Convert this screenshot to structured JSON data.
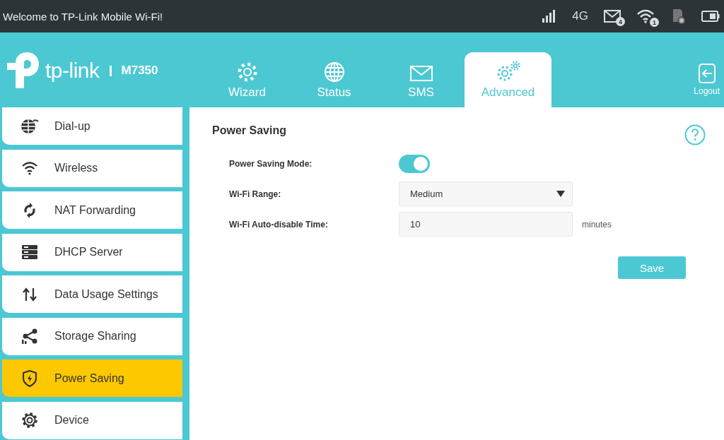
{
  "status_bar": {
    "title": "Welcome to TP-Link Mobile Wi-Fi!",
    "network": "4G",
    "sms_count": "4",
    "wifi_clients": "1"
  },
  "header": {
    "brand": "tp-link",
    "model": "M7350",
    "tabs": [
      {
        "label": "Wizard",
        "selected": false
      },
      {
        "label": "Status",
        "selected": false
      },
      {
        "label": "SMS",
        "selected": false
      },
      {
        "label": "Advanced",
        "selected": true
      }
    ],
    "logout": "Logout"
  },
  "sidebar": {
    "items": [
      {
        "label": "Dial-up",
        "selected": false
      },
      {
        "label": "Wireless",
        "selected": false
      },
      {
        "label": "NAT Forwarding",
        "selected": false
      },
      {
        "label": "DHCP Server",
        "selected": false
      },
      {
        "label": "Data Usage Settings",
        "selected": false
      },
      {
        "label": "Storage Sharing",
        "selected": false
      },
      {
        "label": "Power Saving",
        "selected": true
      },
      {
        "label": "Device",
        "selected": false
      }
    ]
  },
  "content": {
    "title": "Power Saving",
    "fields": [
      {
        "kind": "toggle",
        "label": "Power Saving Mode:",
        "on": true
      },
      {
        "kind": "select",
        "label": "Wi-Fi Range:",
        "value": "Medium"
      },
      {
        "kind": "input",
        "label": "Wi-Fi Auto-disable Time:",
        "value": "10",
        "unit": "minutes"
      }
    ],
    "save": "Save"
  }
}
